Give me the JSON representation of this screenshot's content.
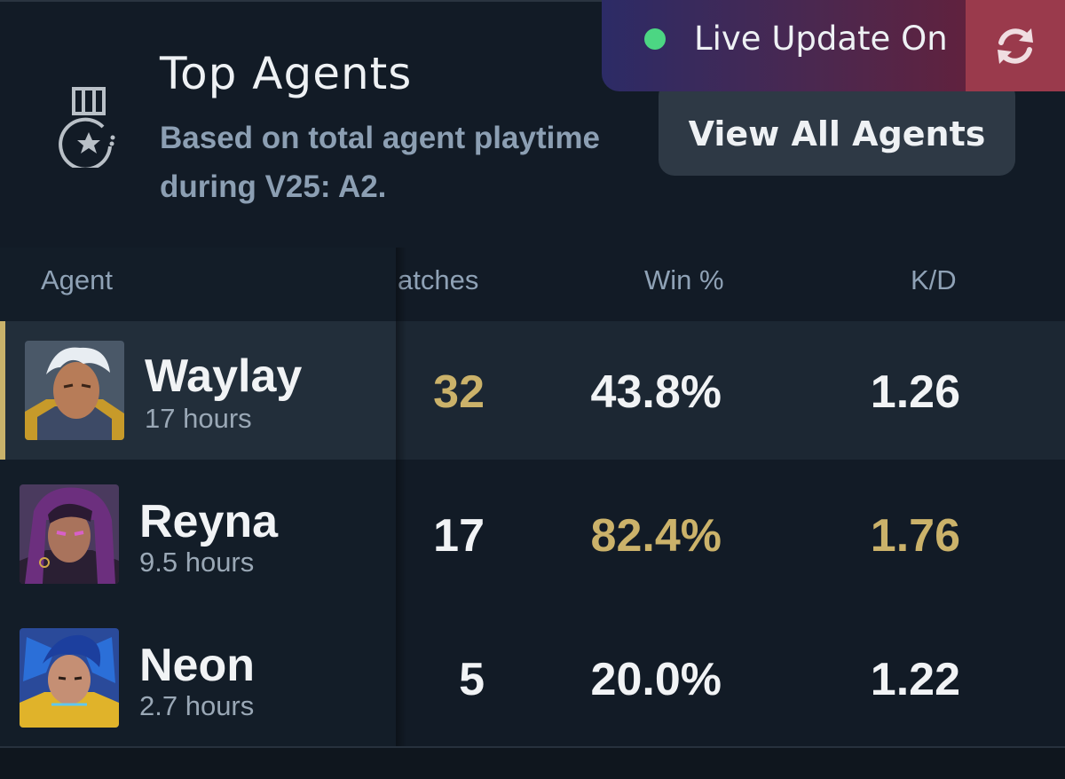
{
  "header": {
    "title": "Top Agents",
    "subtitle": "Based on total agent playtime during V25: A2.",
    "view_all_label": "View All Agents"
  },
  "live_update": {
    "label": "Live Update On",
    "status_color": "#4cd683"
  },
  "table": {
    "columns": [
      "Agent",
      "atches",
      "Win %",
      "K/D"
    ],
    "rows": [
      {
        "name": "Waylay",
        "hours": "17 hours",
        "matches": "32",
        "win": "43.8%",
        "kd": "1.26",
        "selected": true
      },
      {
        "name": "Reyna",
        "hours": "9.5 hours",
        "matches": "17",
        "win": "82.4%",
        "kd": "1.76",
        "selected": false
      },
      {
        "name": "Neon",
        "hours": "2.7 hours",
        "matches": "5",
        "win": "20.0%",
        "kd": "1.22",
        "selected": false
      }
    ]
  },
  "colors": {
    "accent_gold": "#cbb26a",
    "background": "#121b26"
  }
}
